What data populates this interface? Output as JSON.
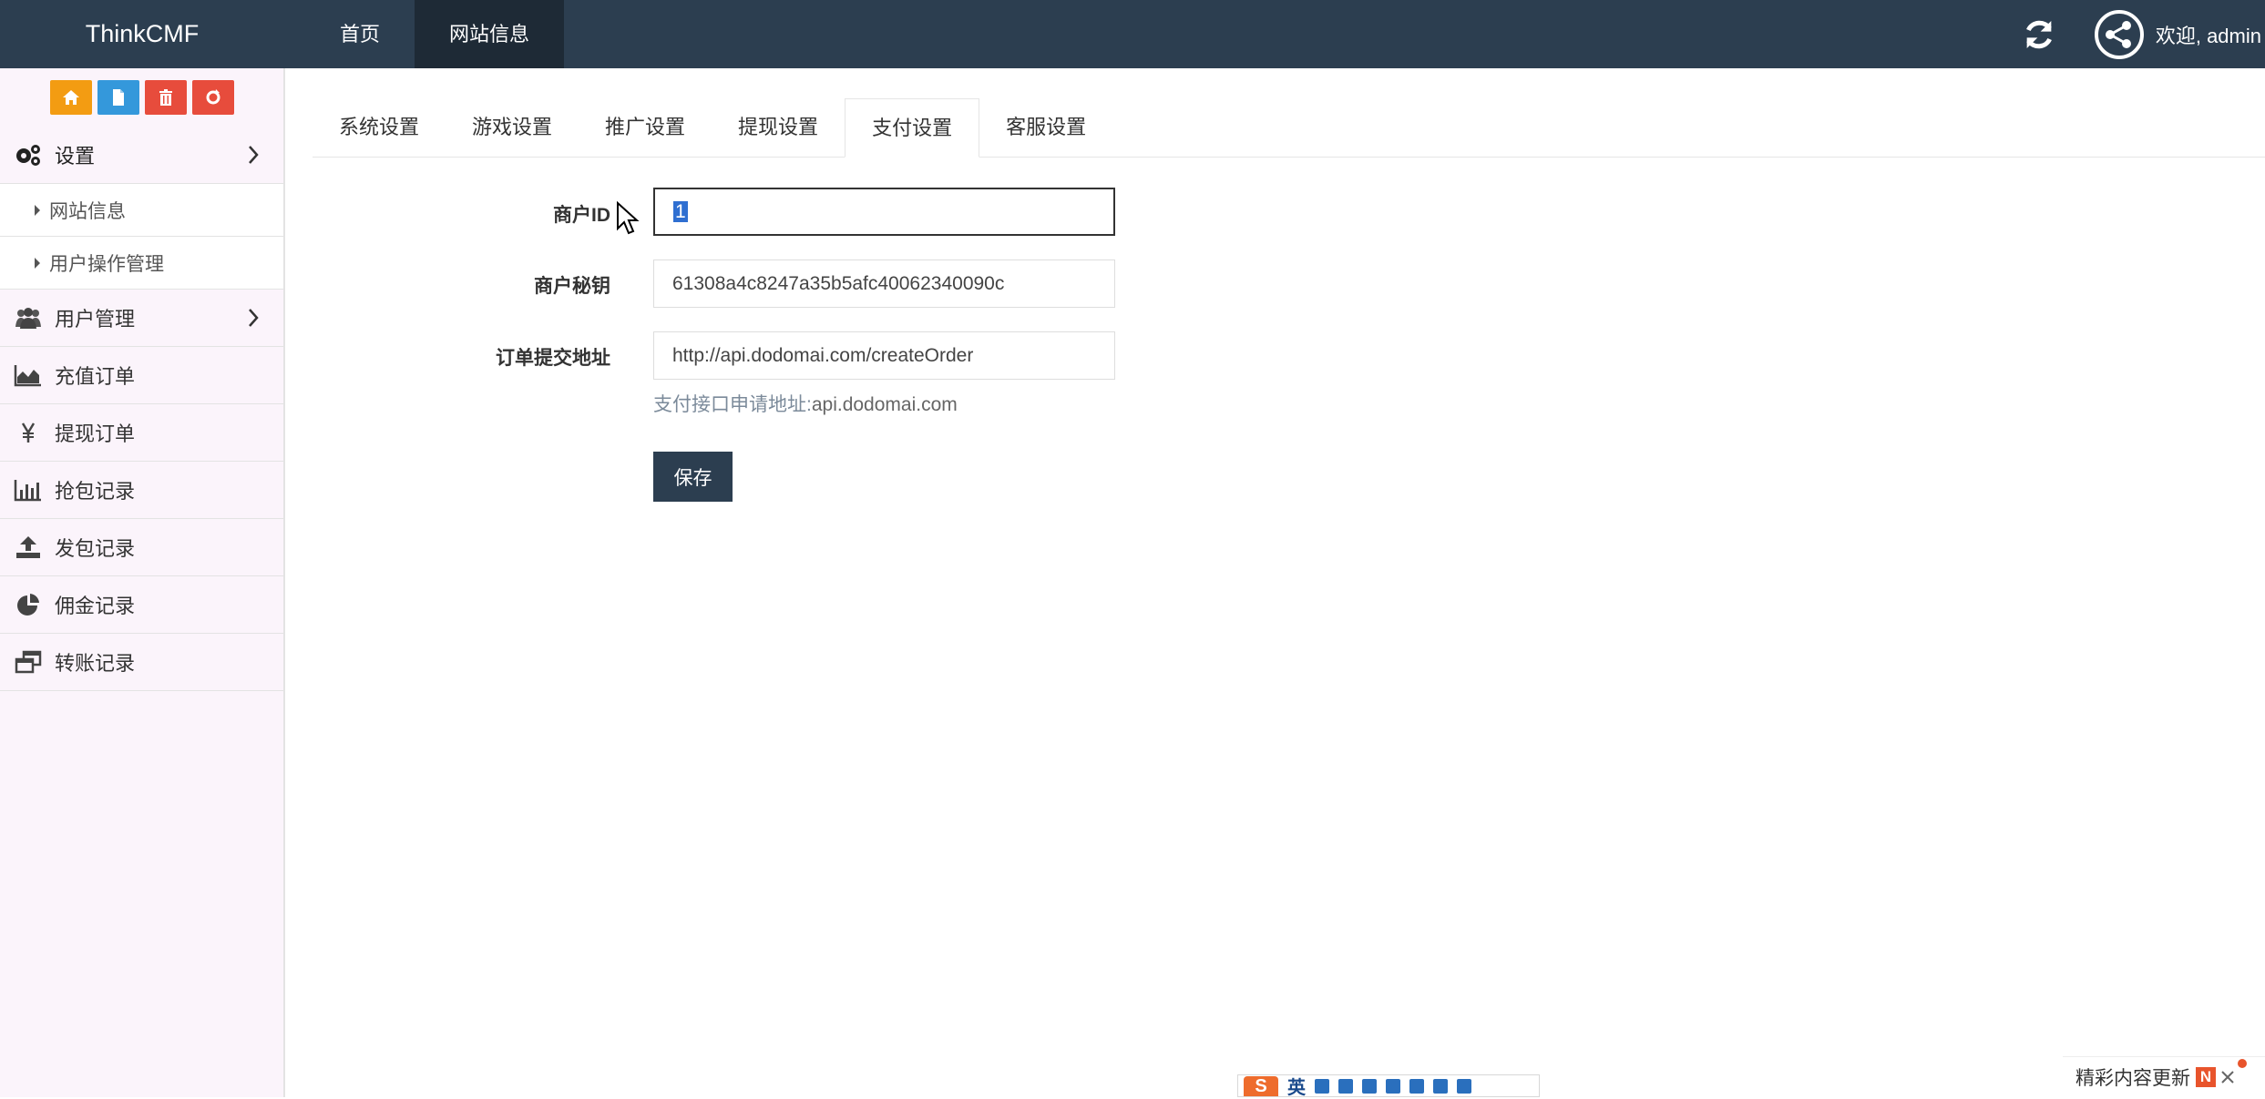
{
  "brand": "ThinkCMF",
  "topnav": [
    {
      "label": "首页"
    },
    {
      "label": "网站信息"
    }
  ],
  "user": {
    "welcome": "欢迎, admin"
  },
  "sidebar": {
    "menu_settings": "设置",
    "sub_items": [
      {
        "label": "网站信息"
      },
      {
        "label": "用户操作管理"
      }
    ],
    "menu_users": "用户管理",
    "items": [
      {
        "label": "充值订单",
        "icon": "area-chart-icon"
      },
      {
        "label": "提现订单",
        "icon": "yen-icon"
      },
      {
        "label": "抢包记录",
        "icon": "bar-chart-icon"
      },
      {
        "label": "发包记录",
        "icon": "upload-icon"
      },
      {
        "label": "佣金记录",
        "icon": "pie-chart-icon"
      },
      {
        "label": "转账记录",
        "icon": "window-restore-icon"
      }
    ]
  },
  "tabs": [
    {
      "label": "系统设置"
    },
    {
      "label": "游戏设置"
    },
    {
      "label": "推广设置"
    },
    {
      "label": "提现设置"
    },
    {
      "label": "支付设置"
    },
    {
      "label": "客服设置"
    }
  ],
  "form": {
    "merchant_id_label": "商户ID",
    "merchant_id_value": "1",
    "merchant_key_label": "商户秘钥",
    "merchant_key_value": "61308a4c8247a35b5afc40062340090c",
    "order_url_label": "订单提交地址",
    "order_url_value": "http://api.dodomai.com/createOrder",
    "help_label": "支付接口申请地址:",
    "help_value": "api.dodomai.com",
    "save_label": "保存"
  },
  "ime": {
    "mode": "英"
  },
  "notification": {
    "text": "精彩内容更新",
    "badge": "N"
  },
  "colors": {
    "topbar": "#2c3e50",
    "sidebar_bg": "#fbf4fb",
    "quick_orange": "#f39c12",
    "quick_blue": "#3498db",
    "quick_red": "#e74c3c",
    "save_button": "#2c3e50"
  }
}
